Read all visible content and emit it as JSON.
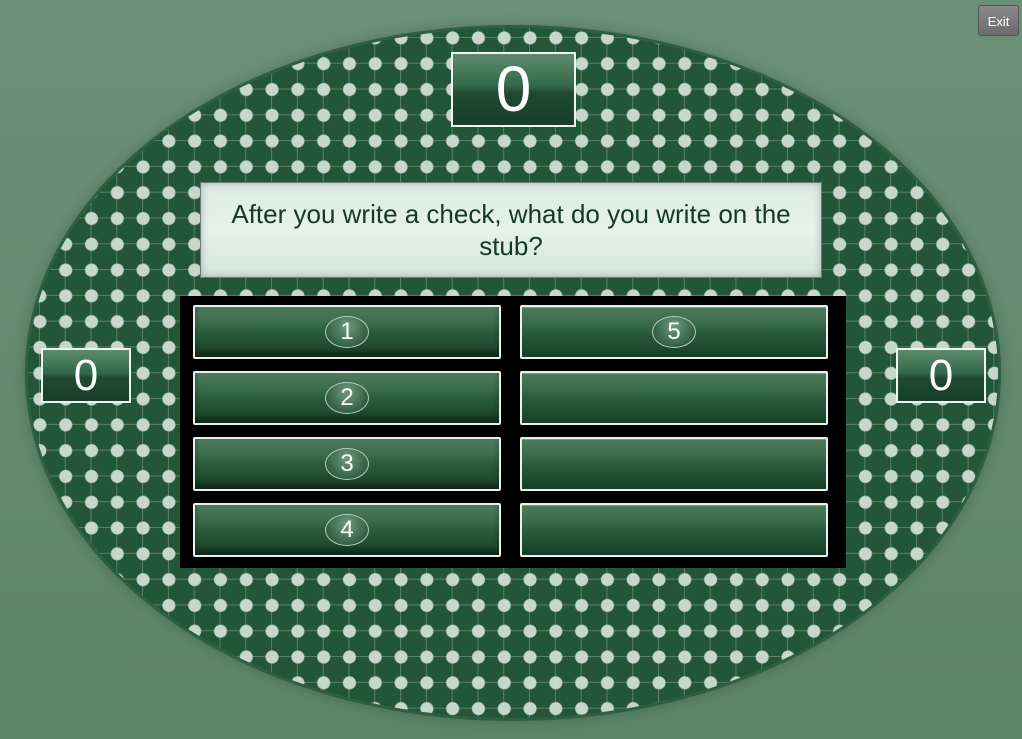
{
  "game": {
    "scores": {
      "top": "0",
      "left": "0",
      "right": "0"
    },
    "question": "After you write a check, what do you write on the stub?",
    "answers": [
      {
        "number": "1"
      },
      {
        "number": "2"
      },
      {
        "number": "3"
      },
      {
        "number": "4"
      },
      {
        "number": "5"
      },
      {
        "number": ""
      },
      {
        "number": ""
      },
      {
        "number": ""
      }
    ]
  },
  "controls": {
    "exit_label": "Exit"
  },
  "colors": {
    "board": "#235538",
    "background": "#6a9178",
    "slot": "#2a5a3c",
    "question_bg": "#e6f2eb",
    "question_text": "#14382a"
  }
}
